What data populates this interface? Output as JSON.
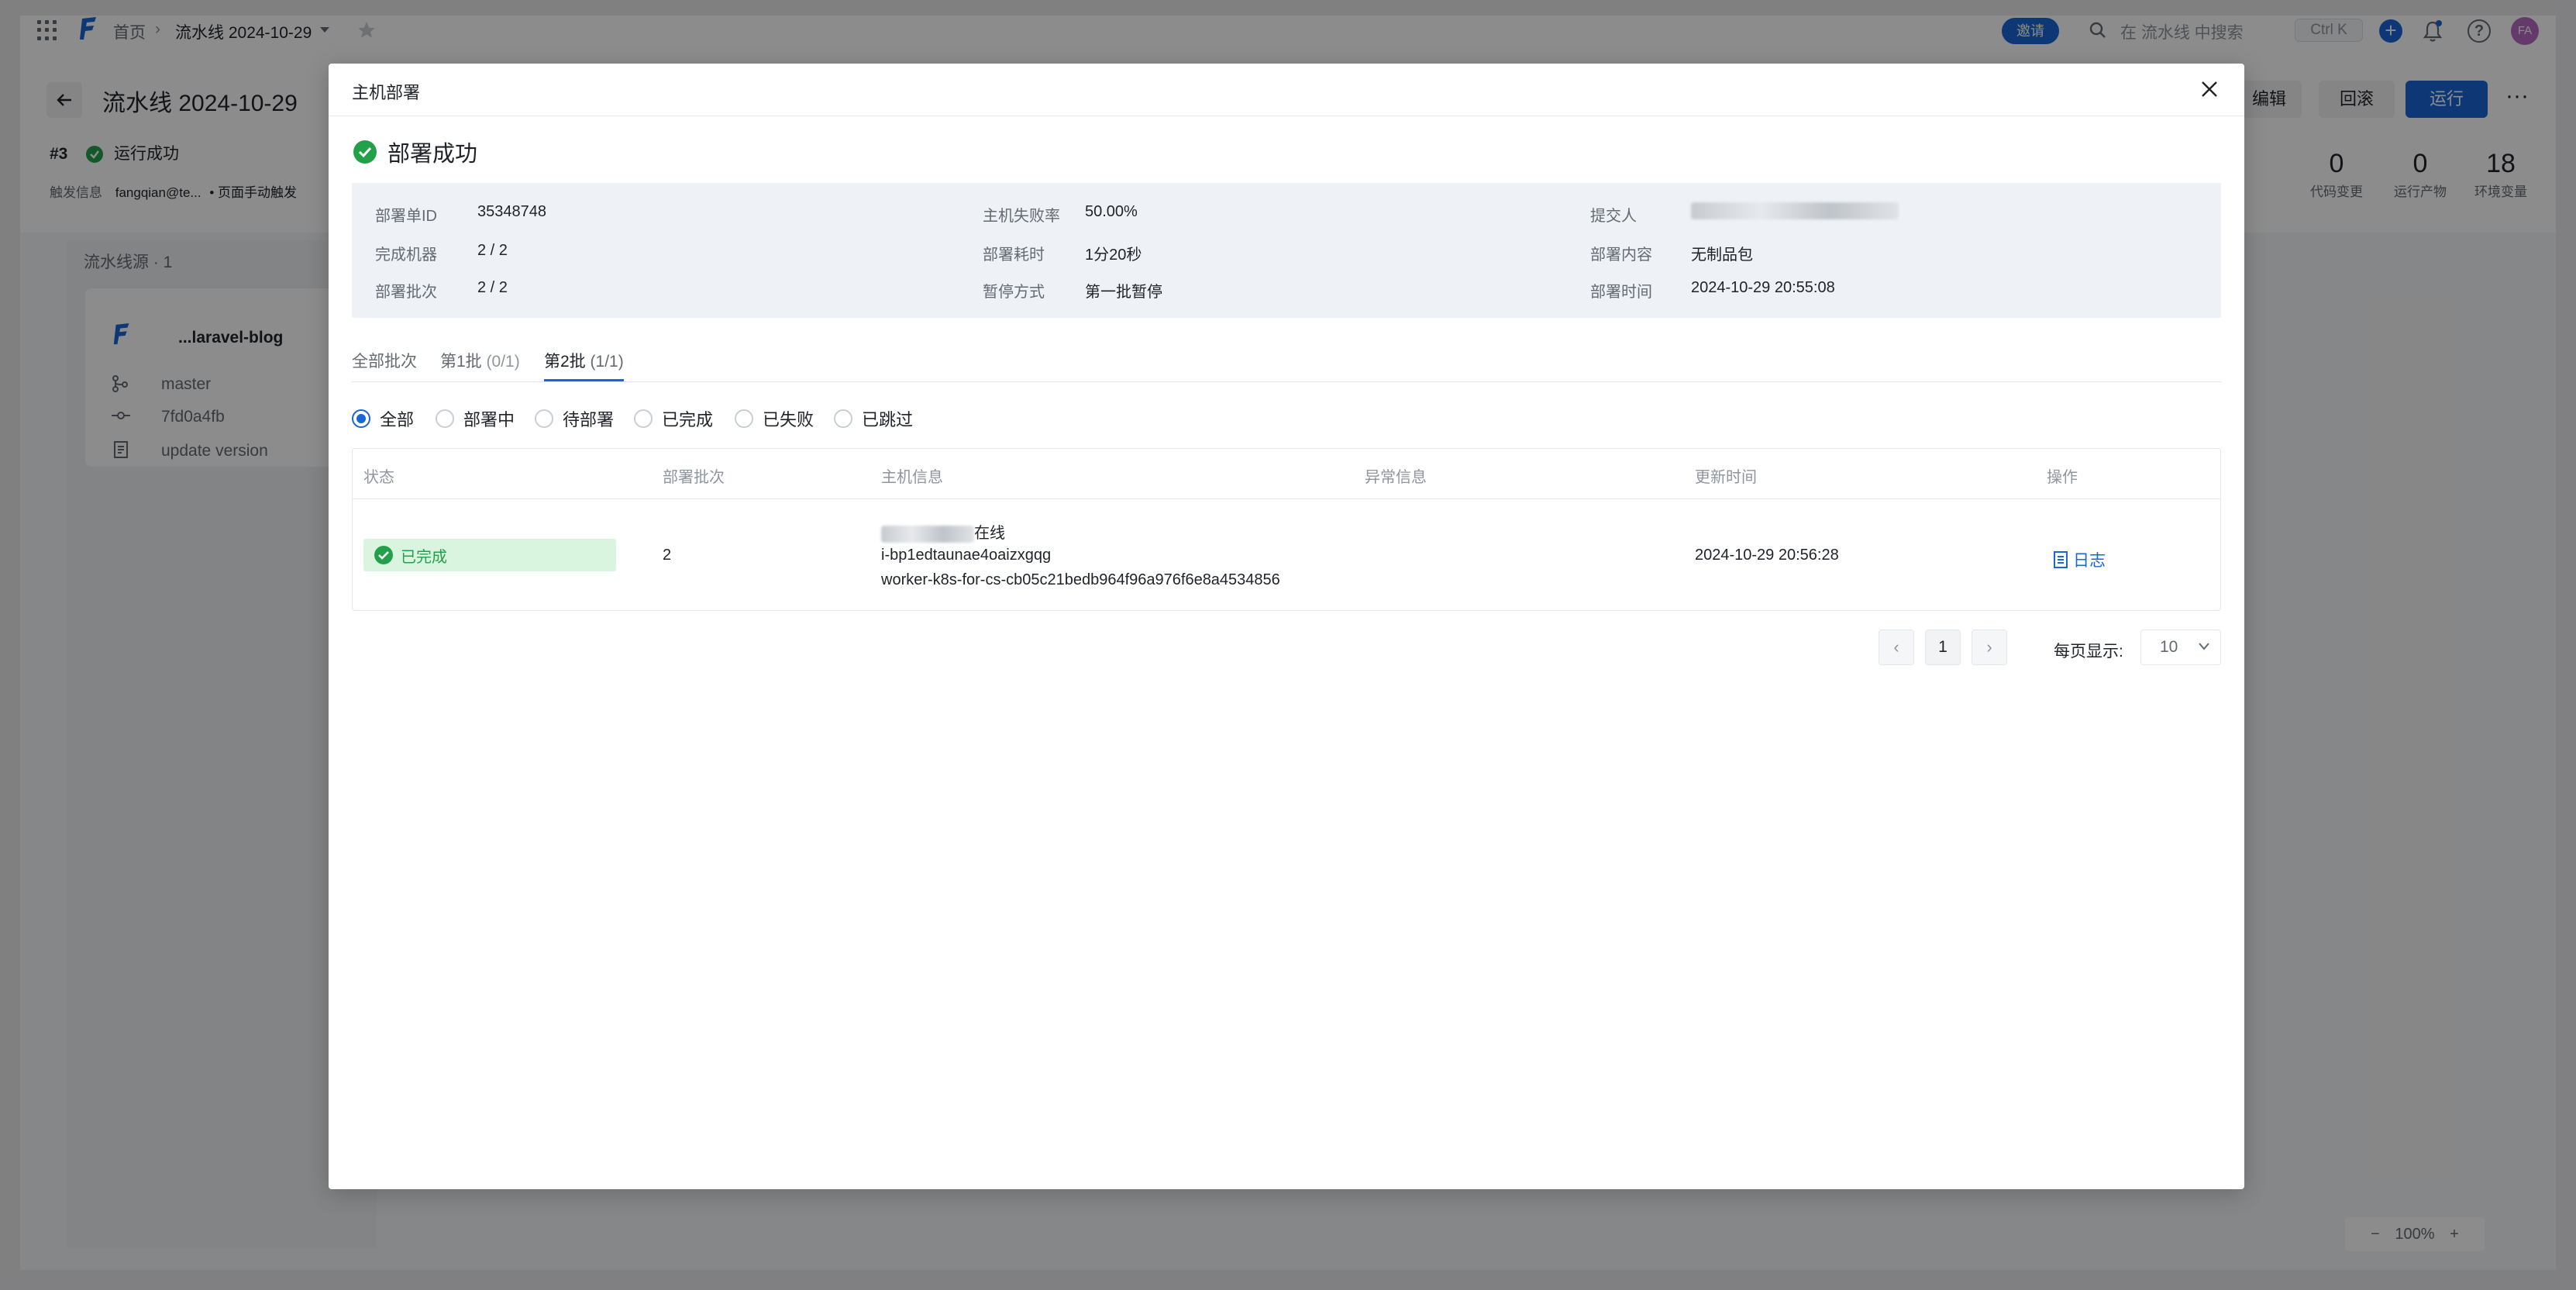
{
  "topbar": {
    "breadcrumb_home": "首页",
    "breadcrumb_pipeline": "流水线 2024-10-29",
    "invite_label": "邀请",
    "search_placeholder": "在 流水线 中搜索",
    "shortcut": "Ctrl K",
    "avatar_initials": "FA"
  },
  "header": {
    "title": "流水线 2024-10-29",
    "run_number": "#3",
    "run_status": "运行成功",
    "trigger_label": "触发信息",
    "trigger_user": "fangqian@te...",
    "trigger_mode": "• 页面手动触发",
    "buttons": {
      "edit": "编辑",
      "rollback": "回滚",
      "run": "运行"
    },
    "stats": [
      {
        "value": "0",
        "label": "代码变更"
      },
      {
        "value": "0",
        "label": "运行产物"
      },
      {
        "value": "18",
        "label": "环境变量"
      }
    ]
  },
  "source_panel": {
    "title": "流水线源 · 1",
    "repo_name": "...laravel-blog",
    "branch": "master",
    "commit": "7fd0a4fb",
    "message": "update version"
  },
  "zoom": {
    "level": "100%"
  },
  "modal": {
    "title": "主机部署",
    "status_text": "部署成功",
    "info": {
      "deploy_id_label": "部署单ID",
      "deploy_id": "35348748",
      "finished_label": "完成机器",
      "finished": "2 / 2",
      "batch_label": "部署批次",
      "batch": "2 / 2",
      "fail_rate_label": "主机失败率",
      "fail_rate": "50.00%",
      "duration_label": "部署耗时",
      "duration": "1分20秒",
      "pause_label": "暂停方式",
      "pause": "第一批暂停",
      "submitter_label": "提交人",
      "content_label": "部署内容",
      "content": "无制品包",
      "time_label": "部署时间",
      "time": "2024-10-29 20:55:08"
    },
    "tabs": [
      {
        "label": "全部批次",
        "count": ""
      },
      {
        "label": "第1批",
        "count": "(0/1)"
      },
      {
        "label": "第2批",
        "count": "(1/1)"
      }
    ],
    "filters": [
      "全部",
      "部署中",
      "待部署",
      "已完成",
      "已失败",
      "已跳过"
    ],
    "table": {
      "headers": [
        "状态",
        "部署批次",
        "主机信息",
        "异常信息",
        "更新时间",
        "操作"
      ],
      "rows": [
        {
          "status": "已完成",
          "batch": "2",
          "host_online": "在线",
          "host_id": "i-bp1edtaunae4oaizxgqg",
          "host_name": "worker-k8s-for-cs-cb05c21bedb964f96a976f6e8a4534856",
          "error": "",
          "updated": "2024-10-29 20:56:28",
          "action": "日志"
        }
      ]
    },
    "pagination": {
      "page": "1",
      "page_size_label": "每页显示:",
      "page_size": "10"
    }
  }
}
